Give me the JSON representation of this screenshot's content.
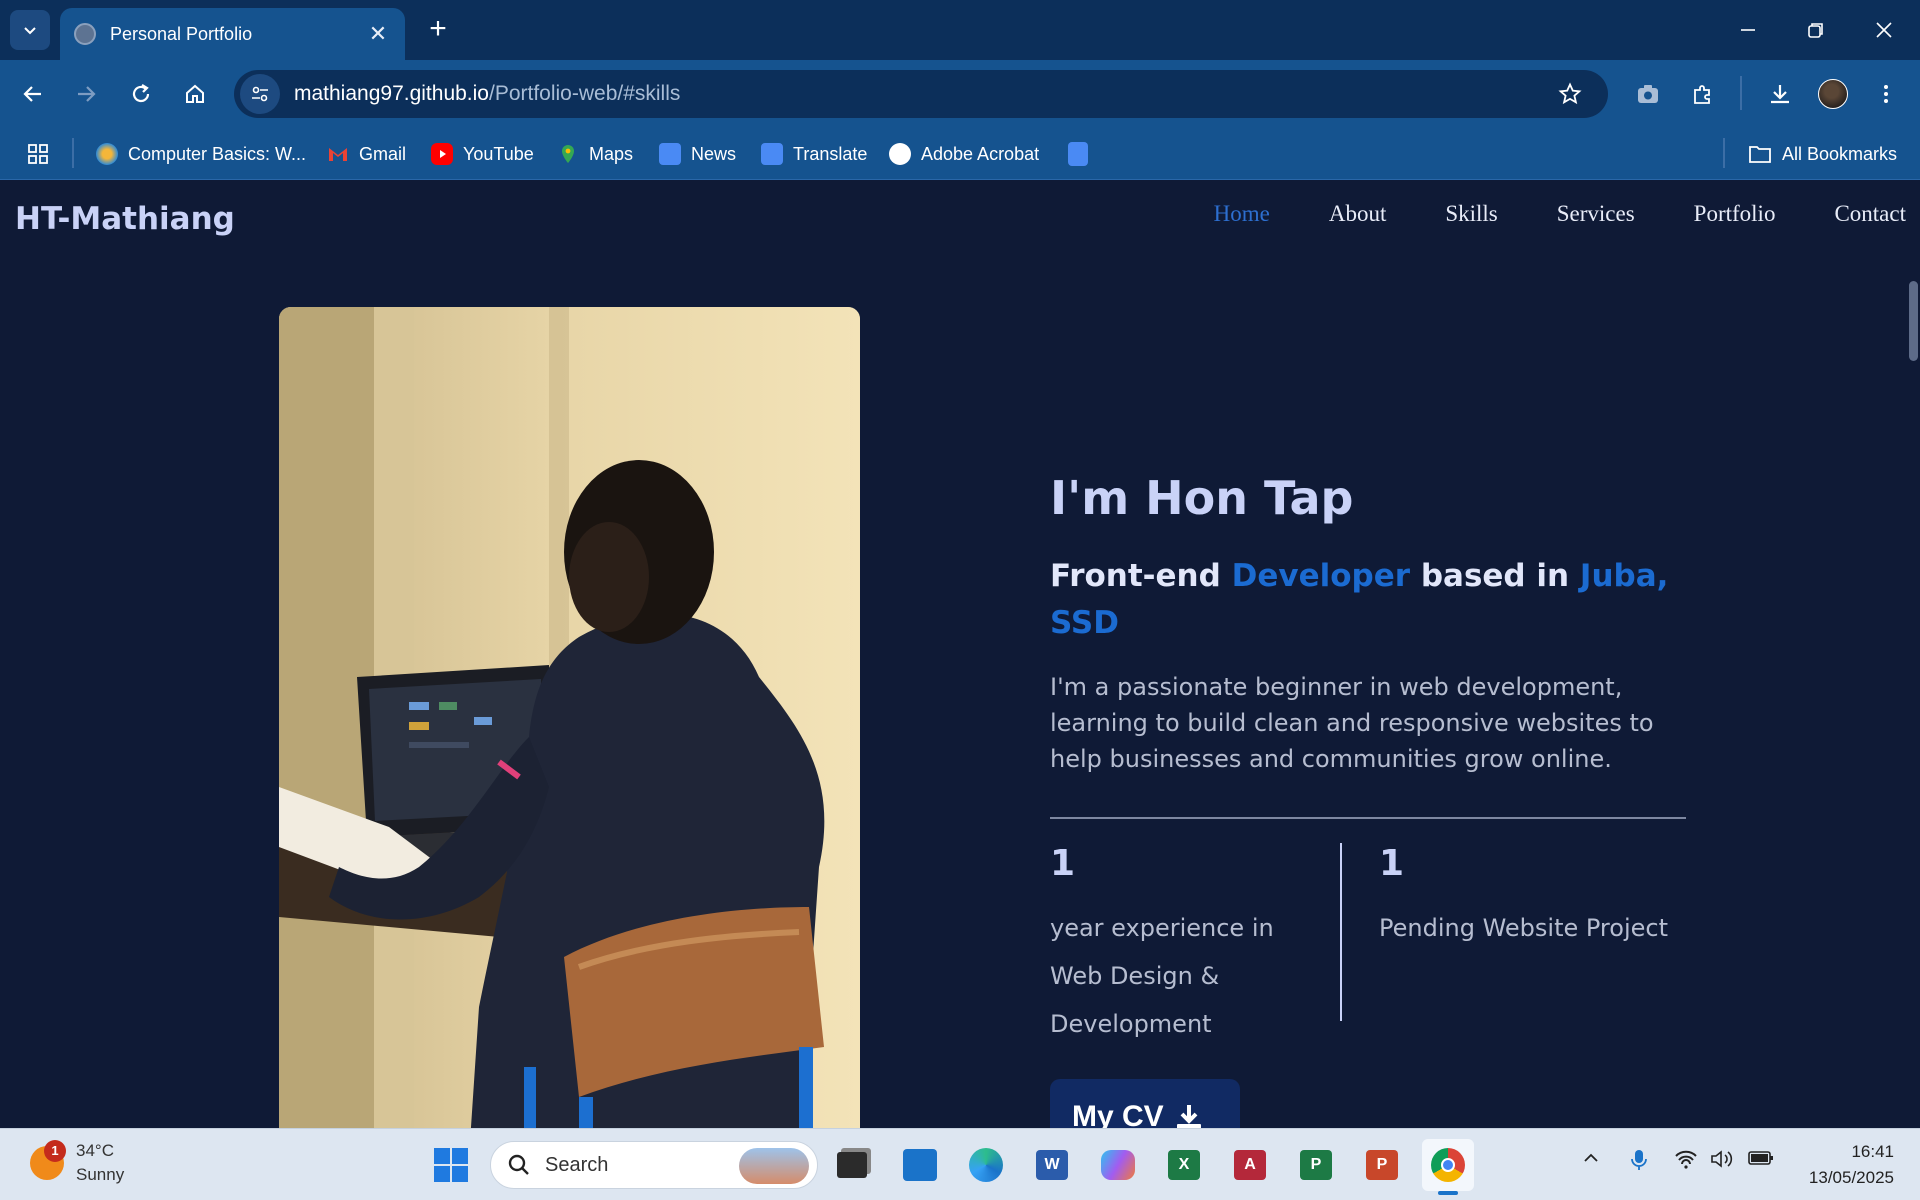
{
  "browser": {
    "tab_title": "Personal Portfolio",
    "url_host": "mathiang97.github.io",
    "url_path": "/Portfolio-web/#skills",
    "bookmarks": [
      {
        "label": "Computer Basics: W..."
      },
      {
        "label": "Gmail"
      },
      {
        "label": "YouTube"
      },
      {
        "label": "Maps"
      },
      {
        "label": "News"
      },
      {
        "label": "Translate"
      },
      {
        "label": "Adobe Acrobat"
      }
    ],
    "all_bookmarks": "All Bookmarks"
  },
  "site": {
    "logo": "HT-Mathiang",
    "nav": [
      "Home",
      "About",
      "Skills",
      "Services",
      "Portfolio",
      "Contact"
    ],
    "active_nav": "Home"
  },
  "hero": {
    "heading": "I'm Hon Tap",
    "sub_part1": "Front-end ",
    "sub_highlight1": "Developer",
    "sub_part2": " based in ",
    "sub_highlight2": "Juba, SSD",
    "intro": "I'm a passionate beginner in web development, learning to build clean and responsive websites to help businesses and communities grow online.",
    "stats": [
      {
        "number": "1",
        "label": "year experience in Web Design & Development"
      },
      {
        "number": "1",
        "label": "Pending Website Project"
      }
    ],
    "cv_button": "My CV"
  },
  "taskbar": {
    "weather_badge": "1",
    "temperature": "34°C",
    "condition": "Sunny",
    "search_placeholder": "Search",
    "time": "16:41",
    "date": "13/05/2025"
  }
}
